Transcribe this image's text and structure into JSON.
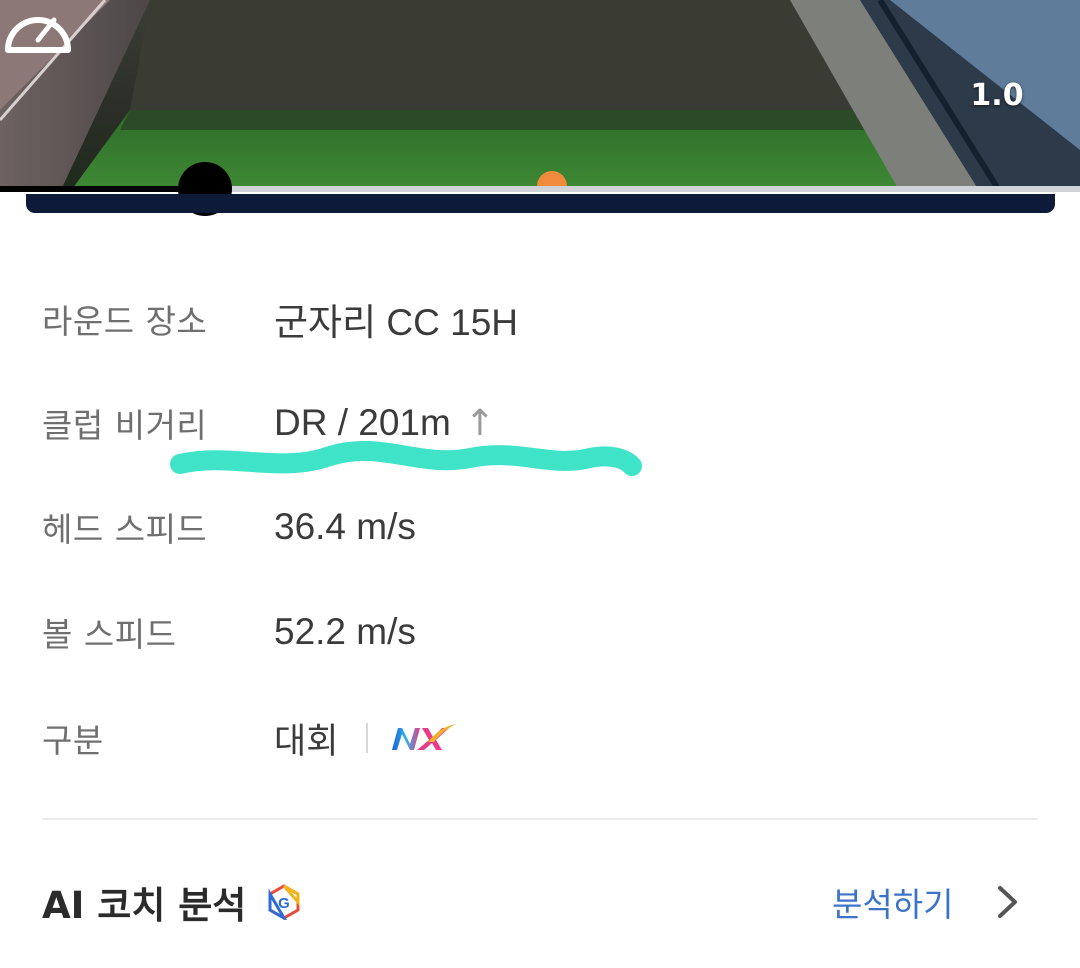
{
  "video": {
    "speed_icon": "speedometer-icon",
    "speed_value": "1.0",
    "playback_progress": 0.19
  },
  "info": {
    "rows": [
      {
        "label": "라운드 장소",
        "value": "군자리 CC 15H"
      },
      {
        "label": "클럽 비거리",
        "value": "DR / 201m",
        "trend_icon": "arrow-up-icon",
        "trend_symbol": "↑"
      },
      {
        "label": "헤드 스피드",
        "value": "36.4 m/s"
      },
      {
        "label": "볼 스피드",
        "value": "52.2 m/s"
      },
      {
        "label": "구분",
        "value": "대회",
        "logo": "NX"
      }
    ],
    "highlight_color": "#3ee3c8"
  },
  "coach": {
    "title": "AI 코치 분석",
    "badge_icon": "g-badge-icon",
    "action_label": "분석하기",
    "action_icon": "chevron-right-icon",
    "action_color": "#3b73c9"
  }
}
